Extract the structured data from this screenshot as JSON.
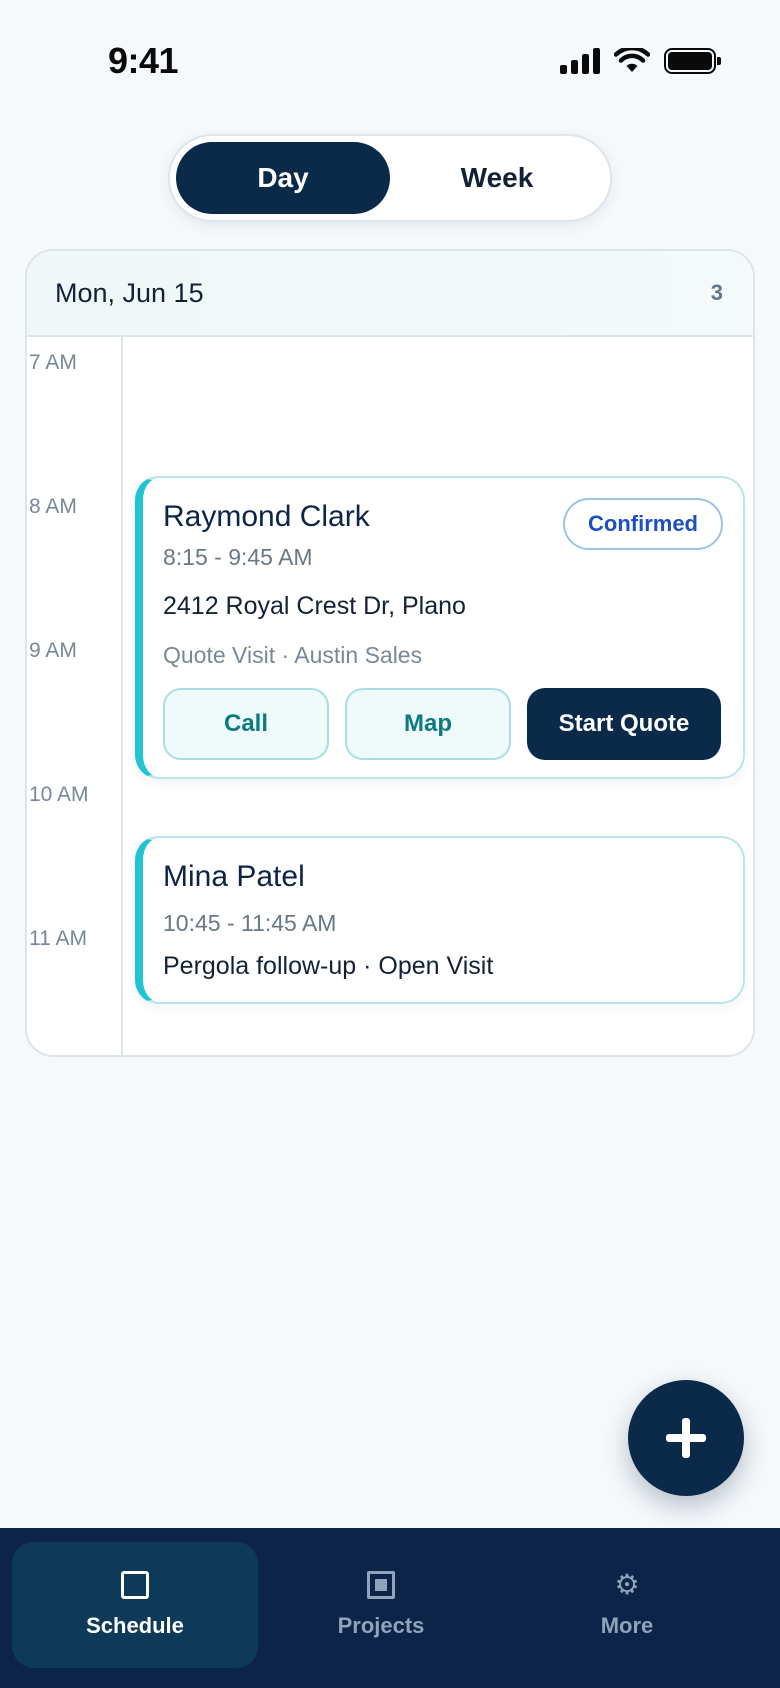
{
  "status_bar": {
    "time": "9:41"
  },
  "view_toggle": {
    "day_label": "Day",
    "week_label": "Week",
    "selected": "Day"
  },
  "calendar": {
    "date_label": "Mon, Jun 15",
    "count": "3",
    "time_labels": [
      "7 AM",
      "8 AM",
      "9 AM",
      "10 AM",
      "11 AM"
    ]
  },
  "events": [
    {
      "name": "Raymond Clark",
      "time": "8:15 - 9:45 AM",
      "address": "2412 Royal Crest Dr, Plano",
      "meta": "Quote Visit · Austin Sales",
      "status": "Confirmed",
      "actions": {
        "call": "Call",
        "map": "Map",
        "start_quote": "Start Quote"
      }
    },
    {
      "name": "Mina Patel",
      "time": "10:45 - 11:45 AM",
      "description": "Pergola follow-up · Open Visit"
    }
  ],
  "tab_bar": {
    "items": [
      {
        "label": "Schedule",
        "icon": "square-icon",
        "active": true
      },
      {
        "label": "Projects",
        "icon": "grid-icon",
        "active": false
      },
      {
        "label": "More",
        "icon": "gear-icon",
        "active": false
      }
    ]
  },
  "icons": {
    "gear_glyph": "⚙"
  },
  "colors": {
    "primary": "#0b2a4a",
    "accent": "#22c4d4",
    "badge_text": "#1d4fc4",
    "background": "#f6f9fb"
  }
}
